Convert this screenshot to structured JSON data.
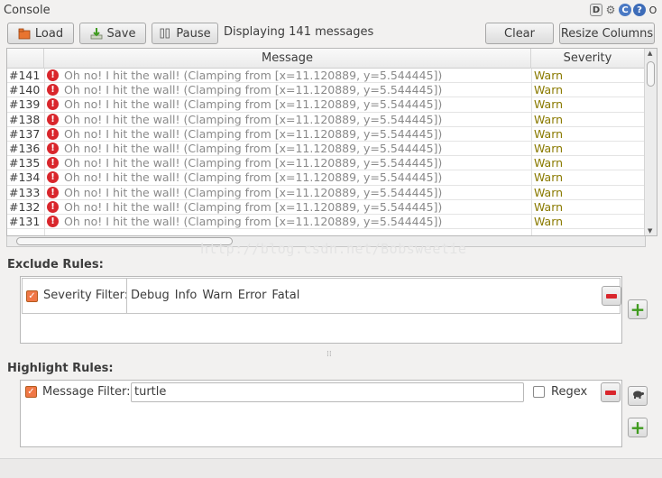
{
  "window": {
    "title": "Console"
  },
  "toolbar": {
    "load_label": "Load",
    "save_label": "Save",
    "pause_label": "Pause",
    "status_text": "Displaying 141 messages",
    "clear_label": "Clear",
    "resize_label": "Resize Columns"
  },
  "table": {
    "col_message": "Message",
    "col_severity": "Severity",
    "rows": [
      {
        "num": "#141",
        "message": "Oh no! I hit the wall! (Clamping from [x=11.120889, y=5.544445])",
        "severity": "Warn"
      },
      {
        "num": "#140",
        "message": "Oh no! I hit the wall! (Clamping from [x=11.120889, y=5.544445])",
        "severity": "Warn"
      },
      {
        "num": "#139",
        "message": "Oh no! I hit the wall! (Clamping from [x=11.120889, y=5.544445])",
        "severity": "Warn"
      },
      {
        "num": "#138",
        "message": "Oh no! I hit the wall! (Clamping from [x=11.120889, y=5.544445])",
        "severity": "Warn"
      },
      {
        "num": "#137",
        "message": "Oh no! I hit the wall! (Clamping from [x=11.120889, y=5.544445])",
        "severity": "Warn"
      },
      {
        "num": "#136",
        "message": "Oh no! I hit the wall! (Clamping from [x=11.120889, y=5.544445])",
        "severity": "Warn"
      },
      {
        "num": "#135",
        "message": "Oh no! I hit the wall! (Clamping from [x=11.120889, y=5.544445])",
        "severity": "Warn"
      },
      {
        "num": "#134",
        "message": "Oh no! I hit the wall! (Clamping from [x=11.120889, y=5.544445])",
        "severity": "Warn"
      },
      {
        "num": "#133",
        "message": "Oh no! I hit the wall! (Clamping from [x=11.120889, y=5.544445])",
        "severity": "Warn"
      },
      {
        "num": "#132",
        "message": "Oh no! I hit the wall! (Clamping from [x=11.120889, y=5.544445])",
        "severity": "Warn"
      },
      {
        "num": "#131",
        "message": "Oh no! I hit the wall! (Clamping from [x=11.120889, y=5.544445])",
        "severity": "Warn"
      }
    ]
  },
  "watermark": "http://blog.csdn.net/Bobsweetie",
  "exclude": {
    "label": "Exclude Rules:",
    "severity_label": "Severity Filter:",
    "levels": [
      "Debug",
      "Info",
      "Warn",
      "Error",
      "Fatal"
    ]
  },
  "highlight": {
    "label": "Highlight Rules:",
    "message_label": "Message Filter:",
    "message_value": "turtle",
    "regex_label": "Regex"
  },
  "colors": {
    "error_icon": "#d9262c",
    "warn_text": "#8a7a00",
    "checkbox_accent": "#f07746",
    "add_green": "#3f9b1e"
  }
}
